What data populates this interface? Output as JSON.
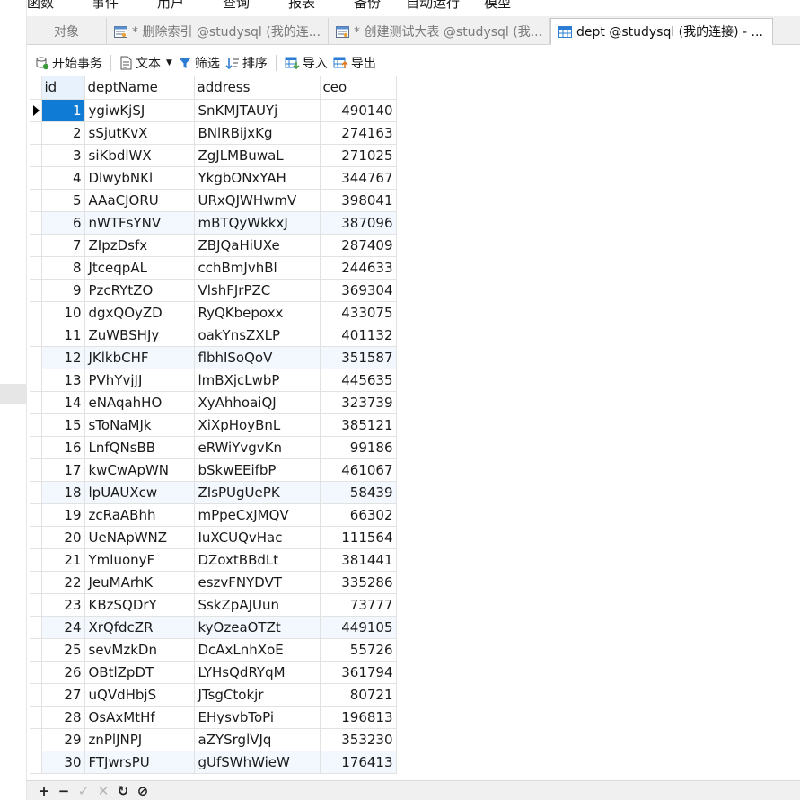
{
  "menu": [
    "函数",
    "事件",
    "用户",
    "查询",
    "报表",
    "备份",
    "自动运行",
    "模型"
  ],
  "tabs": [
    {
      "label": "对象",
      "icon": "none"
    },
    {
      "label": "* 删除索引 @studysql (我的连...",
      "icon": "query-icon"
    },
    {
      "label": "* 创建测试大表 @studysql (我...",
      "icon": "query-icon"
    },
    {
      "label": "dept @studysql (我的连接) - ...",
      "icon": "table-icon",
      "active": true
    }
  ],
  "toolbar": {
    "begin_transaction": "开始事务",
    "text": "文本",
    "filter": "筛选",
    "sort": "排序",
    "import": "导入",
    "export": "导出"
  },
  "columns": [
    "id",
    "deptName",
    "address",
    "ceo"
  ],
  "rows": [
    [
      "1",
      "ygiwKjSJ",
      "SnKMJTAUYj",
      "490140"
    ],
    [
      "2",
      "sSjutKvX",
      "BNlRBijxKg",
      "274163"
    ],
    [
      "3",
      "siKbdlWX",
      "ZgJLMBuwaL",
      "271025"
    ],
    [
      "4",
      "DlwybNKl",
      "YkgbONxYAH",
      "344767"
    ],
    [
      "5",
      "AAaCJORU",
      "URxQJWHwmV",
      "398041"
    ],
    [
      "6",
      "nWTFsYNV",
      "mBTQyWkkxJ",
      "387096"
    ],
    [
      "7",
      "ZIpzDsfx",
      "ZBJQaHiUXe",
      "287409"
    ],
    [
      "8",
      "JtceqpAL",
      "cchBmJvhBl",
      "244633"
    ],
    [
      "9",
      "PzcRYtZO",
      "VlshFJrPZC",
      "369304"
    ],
    [
      "10",
      "dgxQOyZD",
      "RyQKbepoxx",
      "433075"
    ],
    [
      "11",
      "ZuWBSHJy",
      "oakYnsZXLP",
      "401132"
    ],
    [
      "12",
      "JKlkbCHF",
      "flbhISoQoV",
      "351587"
    ],
    [
      "13",
      "PVhYvjJJ",
      "lmBXjcLwbP",
      "445635"
    ],
    [
      "14",
      "eNAqahHO",
      "XyAhhoaiQJ",
      "323739"
    ],
    [
      "15",
      "sToNaMJk",
      "XiXpHoyBnL",
      "385121"
    ],
    [
      "16",
      "LnfQNsBB",
      "eRWiYvgvKn",
      "99186"
    ],
    [
      "17",
      "kwCwApWN",
      "bSkwEEifbP",
      "461067"
    ],
    [
      "18",
      "lpUAUXcw",
      "ZIsPUgUePK",
      "58439"
    ],
    [
      "19",
      "zcRaABhh",
      "mPpeCxJMQV",
      "66302"
    ],
    [
      "20",
      "UeNApWNZ",
      "IuXCUQvHac",
      "111564"
    ],
    [
      "21",
      "YmluonyF",
      "DZoxtBBdLt",
      "381441"
    ],
    [
      "22",
      "JeuMArhK",
      "eszvFNYDVT",
      "335286"
    ],
    [
      "23",
      "KBzSQDrY",
      "SskZpAJUun",
      "73777"
    ],
    [
      "24",
      "XrQfdcZR",
      "kyOzeaOTZt",
      "449105"
    ],
    [
      "25",
      "sevMzkDn",
      "DcAxLnhXoE",
      "55726"
    ],
    [
      "26",
      "OBtlZpDT",
      "LYHsQdRYqM",
      "361794"
    ],
    [
      "27",
      "uQVdHbjS",
      "JTsgCtokjr",
      "80721"
    ],
    [
      "28",
      "OsAxMtHf",
      "EHysvbToPi",
      "196813"
    ],
    [
      "29",
      "znPlJNPJ",
      "aZYSrglVJq",
      "353230"
    ],
    [
      "30",
      "FTJwrsPU",
      "gUfSWhWieW",
      "176413"
    ]
  ],
  "bottom_buttons": [
    {
      "name": "add-record-button",
      "glyph": "+",
      "enabled": true
    },
    {
      "name": "delete-record-button",
      "glyph": "−",
      "enabled": true
    },
    {
      "name": "apply-changes-button",
      "glyph": "✓",
      "enabled": false
    },
    {
      "name": "discard-changes-button",
      "glyph": "✕",
      "enabled": false
    },
    {
      "name": "refresh-button",
      "glyph": "↻",
      "enabled": true
    },
    {
      "name": "stop-button",
      "glyph": "⊘",
      "enabled": true
    }
  ],
  "colors": {
    "selection": "#0f7bd5",
    "alt_row": "#f2f8fe",
    "toolbar_icon_blue": "#2b7cd3",
    "toolbar_icon_green": "#3a9a3a"
  }
}
